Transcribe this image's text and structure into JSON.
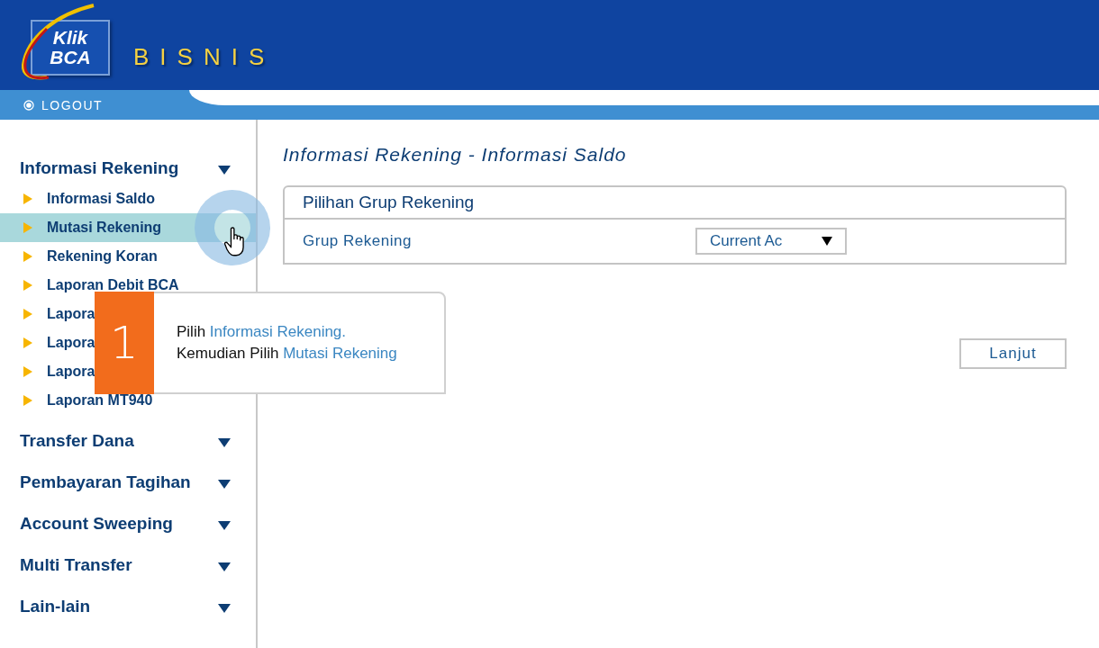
{
  "header": {
    "logo_top": "Klik",
    "logo_bottom": "BCA",
    "title": "BISNIS"
  },
  "logout": "LOGOUT",
  "sidebar": {
    "groups": [
      {
        "label": "Informasi Rekening",
        "expanded": true,
        "items": [
          {
            "label": "Informasi Saldo",
            "selected": false
          },
          {
            "label": "Mutasi Rekening",
            "selected": true
          },
          {
            "label": "Rekening Koran",
            "selected": false
          },
          {
            "label": "Laporan Debit BCA",
            "selected": false
          },
          {
            "label": "Lapora",
            "selected": false
          },
          {
            "label": "Lapora",
            "selected": false
          },
          {
            "label": "Lapora",
            "selected": false
          },
          {
            "label": "Laporan MT940",
            "selected": false
          }
        ]
      },
      {
        "label": "Transfer Dana",
        "expanded": false
      },
      {
        "label": "Pembayaran Tagihan",
        "expanded": false
      },
      {
        "label": "Account Sweeping",
        "expanded": false
      },
      {
        "label": "Multi Transfer",
        "expanded": false
      },
      {
        "label": "Lain-lain",
        "expanded": false
      }
    ]
  },
  "main": {
    "title": "Informasi Rekening - Informasi Saldo",
    "panel": {
      "title": "Pilihan Grup Rekening",
      "field_label": "Grup Rekening",
      "select_value": "Current Ac"
    },
    "button": "Lanjut"
  },
  "callout": {
    "number": "1",
    "lines": [
      {
        "text": "Pilih",
        "highlight": "Informasi Rekening."
      },
      {
        "text": "Kemudian Pilih",
        "highlight": "Mutasi Rekening"
      }
    ]
  }
}
